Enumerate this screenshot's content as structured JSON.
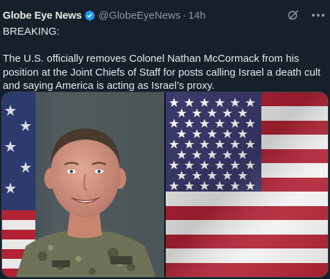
{
  "tweet": {
    "author_name": "Globe Eye News",
    "handle": "@GlobeEyeNews",
    "separator": "·",
    "time": "14h",
    "headline": "BREAKING:",
    "body": "The U.S. officially removes Colonel Nathan McCormack from his position at the Joint Chiefs of Staff for posts calling Israel a death cult and saying America is acting as Israel’s proxy."
  },
  "icons": {
    "verified": "verified-badge-icon",
    "grok": "grok-icon",
    "more": "more-options-icon"
  },
  "media": {
    "left": "officer-portrait-photo",
    "right": "us-flag-photo"
  },
  "colors": {
    "background": "#15202b",
    "text": "#e7e9ea",
    "secondary": "#8b98a5",
    "verified": "#1d9bf0",
    "flag_red": "#b22234",
    "flag_blue": "#3c3b6e"
  }
}
